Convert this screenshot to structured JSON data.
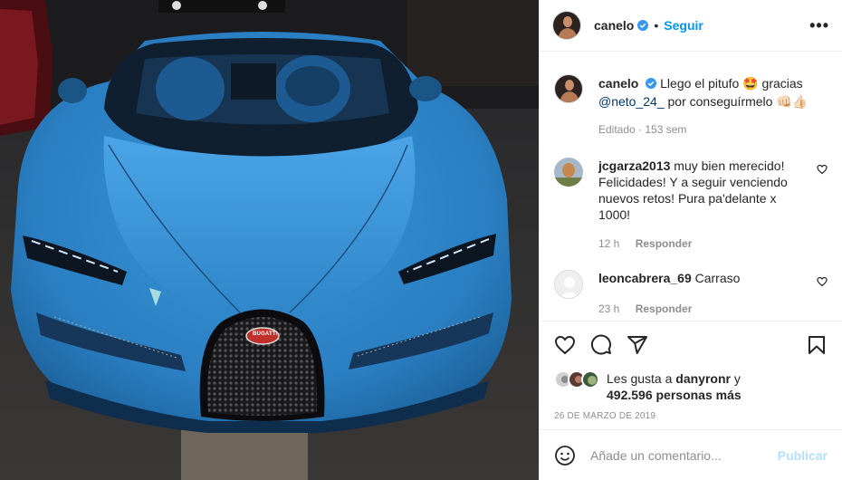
{
  "post": {
    "author": "canelo",
    "follow_label": "Seguir",
    "dot": "•",
    "more_label": "•••",
    "caption": {
      "author": "canelo",
      "text_1": "Llego el pitufo",
      "emoji_1": "🤩",
      "text_2": "gracias",
      "mention": "@neto_24_",
      "text_3": "por conseguírmelo",
      "emoji_2": "👊🏻👍🏻",
      "meta": "Editado · 153 sem"
    },
    "comments": [
      {
        "user": "jcgarza2013",
        "text": "muy bien merecido! Felicidades! Y a seguir venciendo nuevos retos! Pura pa'delante x 1000!",
        "time": "12 h",
        "reply_label": "Responder"
      },
      {
        "user": "leoncabrera_69",
        "text": "Carraso",
        "time": "23 h",
        "reply_label": "Responder"
      }
    ],
    "likes": {
      "prefix": "Les gusta a",
      "user": "danyronr",
      "connector": "y",
      "count_text": "492.596 personas más"
    },
    "date": "26 DE MARZO DE 2019",
    "add_comment": {
      "placeholder": "Añade un comentario...",
      "publish_label": "Publicar"
    },
    "media": {
      "badge_text": "BUGATTI"
    }
  },
  "colors": {
    "accent": "#0095f6",
    "verified": "#3897f0",
    "car_body": "#2f86c9",
    "publish_disabled": "#b2dffc",
    "grille_badge": "#c0312b"
  },
  "icons": [
    "verified-icon",
    "more-icon",
    "heart-icon",
    "comment-icon",
    "share-icon",
    "bookmark-icon",
    "emoji-icon"
  ]
}
